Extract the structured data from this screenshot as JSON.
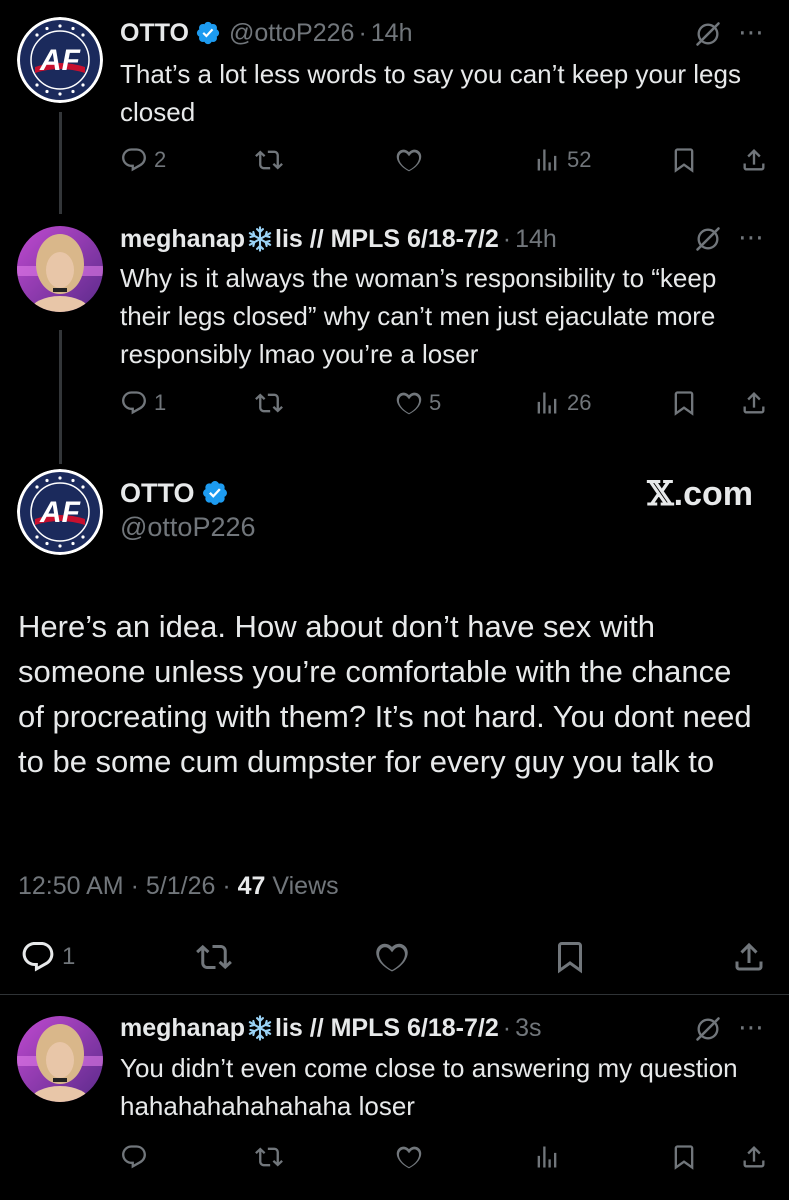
{
  "tweet1": {
    "name": "OTTO",
    "handle": "@ottoP226",
    "dot": "·",
    "time": "14h",
    "text": "That’s a lot less words to say you can’t keep your legs closed",
    "replies": "2",
    "retweets": "",
    "likes": "",
    "views": "52",
    "avatar_label": "AF"
  },
  "tweet2": {
    "name_part1": "meghanap",
    "name_part2": "lis // MPLS 6/18-7/2",
    "dot": "·",
    "time": "14h",
    "text": "Why is it always the woman’s responsibility to “keep their legs closed” why can’t men just ejaculate more responsibly lmao you’re a loser",
    "replies": "1",
    "retweets": "",
    "likes": "5",
    "views": "26"
  },
  "main": {
    "name": "OTTO",
    "handle": "@ottoP226",
    "brand_x": "𝕏",
    "brand_suffix": ".com",
    "text": "Here’s an idea. How about don’t have sex with someone unless you’re comfortable with the chance of procreating with them? It’s not hard. You dont need to be some cum dumpster for every guy you talk to",
    "time": "12:50 AM",
    "dot": "·",
    "date": "5/1/26",
    "views_count": "47",
    "views_label": "Views",
    "replies": "1",
    "avatar_label": "AF"
  },
  "tweet3": {
    "name_part1": "meghanap",
    "name_part2": "lis // MPLS 6/18-7/2",
    "dot": "·",
    "time": "3s",
    "text": "You didn’t even come close to answering my question hahahahahahahaha loser"
  },
  "colors": {
    "background": "#000000",
    "text": "#e7e9ea",
    "muted": "#71767b",
    "verified": "#1d9bf0",
    "thread_line": "#333639",
    "af_navy": "#1b2a5c",
    "af_red": "#c8102e"
  },
  "icons": [
    "reply-icon",
    "retweet-icon",
    "like-icon",
    "views-icon",
    "bookmark-icon",
    "share-icon",
    "verified-badge-icon",
    "grok-icon",
    "more-icon",
    "snowflake-icon"
  ]
}
